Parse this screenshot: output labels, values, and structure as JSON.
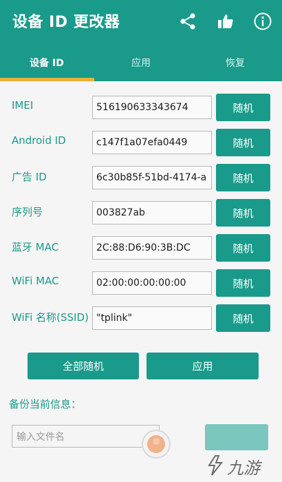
{
  "app": {
    "title": "设备 ID 更改器"
  },
  "colors": {
    "primary": "#1a9a8a",
    "indicator": "#e9b03a"
  },
  "tabs": [
    {
      "label": "设备 ID",
      "active": true
    },
    {
      "label": "应用",
      "active": false
    },
    {
      "label": "恢复",
      "active": false
    }
  ],
  "fields": [
    {
      "label": "IMEI",
      "value": "516190633343674",
      "button": "随机"
    },
    {
      "label": "Android ID",
      "value": "c147f1a07efa0449",
      "button": "随机"
    },
    {
      "label": "广告 ID",
      "value": "6c30b85f-51bd-4174-a",
      "button": "随机"
    },
    {
      "label": "序列号",
      "value": "003827ab",
      "button": "随机"
    },
    {
      "label": "蓝牙 MAC",
      "value": "2C:88:D6:90:3B:DC",
      "button": "随机"
    },
    {
      "label": "WiFi MAC",
      "value": "02:00:00:00:00:00",
      "button": "随机"
    },
    {
      "label": "WiFi 名称(SSID)",
      "value": "\"tplink\"",
      "button": "随机"
    }
  ],
  "actions": {
    "random_all": "全部随机",
    "apply": "应用"
  },
  "backup": {
    "label": "备份当前信息：",
    "filename_placeholder": "输入文件名"
  },
  "icons": {
    "share": "share-icon",
    "like": "thumbs-up-icon",
    "info": "info-icon"
  },
  "watermark": {
    "text": "九游"
  }
}
